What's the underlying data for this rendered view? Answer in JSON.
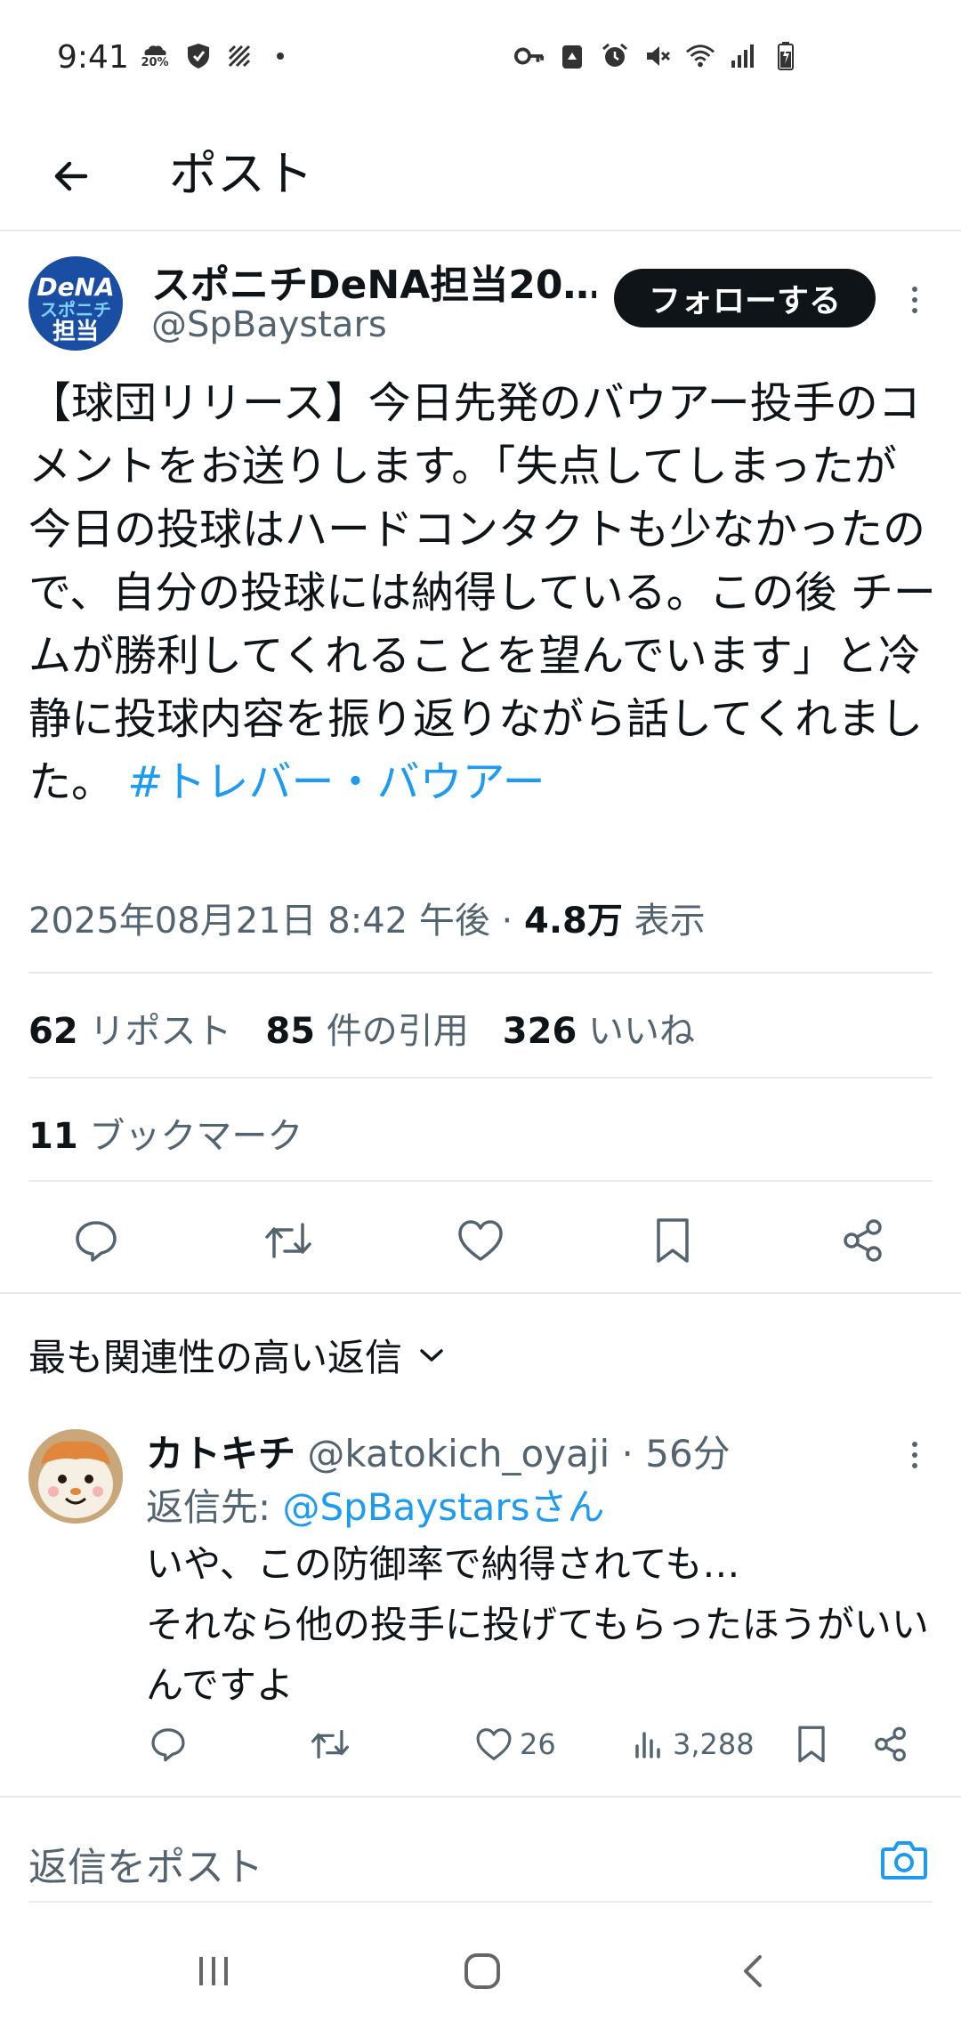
{
  "status_bar": {
    "time": "9:41",
    "left_icons": [
      "weather-20-icon",
      "shield-icon",
      "striped-icon",
      "dot-icon"
    ],
    "weather_label": "20%",
    "right_icons": [
      "key-icon",
      "recycle-icon",
      "alarm-icon",
      "mute-icon",
      "wifi-icon",
      "signal-icon",
      "battery-icon"
    ]
  },
  "header": {
    "back_icon": "arrow-left-icon",
    "title": "ポスト"
  },
  "post": {
    "avatar": {
      "line1": "DeNA",
      "line2": "スポニチ",
      "line3": "担当"
    },
    "author_name": "スポニチDeNA担当20…",
    "author_handle": "@SpBaystars",
    "follow_label": "フォローする",
    "text": "【球団リリース】今日先発のバウアー投手のコメントをお送りします。「失点してしまったが今日の投球はハードコンタクトも少なかったので、自分の投球には納得している。この後 チームが勝利してくれることを望んでいます」と冷静に投球内容を振り返りながら話してくれました。",
    "hashtag": "#トレバー・バウアー",
    "timestamp": "2025年08月21日 8:42 午後 · ",
    "views_count": "4.8万",
    "views_label": " 表示",
    "stats": {
      "reposts_count": "62",
      "reposts_label": " リポスト",
      "quotes_count": "85",
      "quotes_label": " 件の引用",
      "likes_count": "326",
      "likes_label": " いいね"
    },
    "bookmarks_count": "11",
    "bookmarks_label": " ブックマーク",
    "actions": [
      "reply-icon",
      "repost-icon",
      "like-icon",
      "bookmark-icon",
      "share-icon"
    ]
  },
  "replies_sort": {
    "label": "最も関連性の高い返信",
    "icon": "chevron-down-icon"
  },
  "reply": {
    "name": "カトキチ",
    "handle_time": " @katokich_oyaji · 56分",
    "reply_to_prefix": "返信先: ",
    "reply_to_link": "@SpBaystarsさん",
    "text": "いや、この防御率で納得されても…\nそれなら他の投手に投げてもらったほうがいいんですよ",
    "likes": "26",
    "views": "3,288"
  },
  "composer": {
    "placeholder": "返信をポスト",
    "camera_icon": "camera-icon"
  },
  "navbar": [
    "recent-apps-icon",
    "home-icon",
    "back-icon"
  ],
  "colors": {
    "link": "#1d9bf0",
    "text": "#0f1419",
    "secondary": "#536471",
    "follow_bg": "#0f1419"
  }
}
